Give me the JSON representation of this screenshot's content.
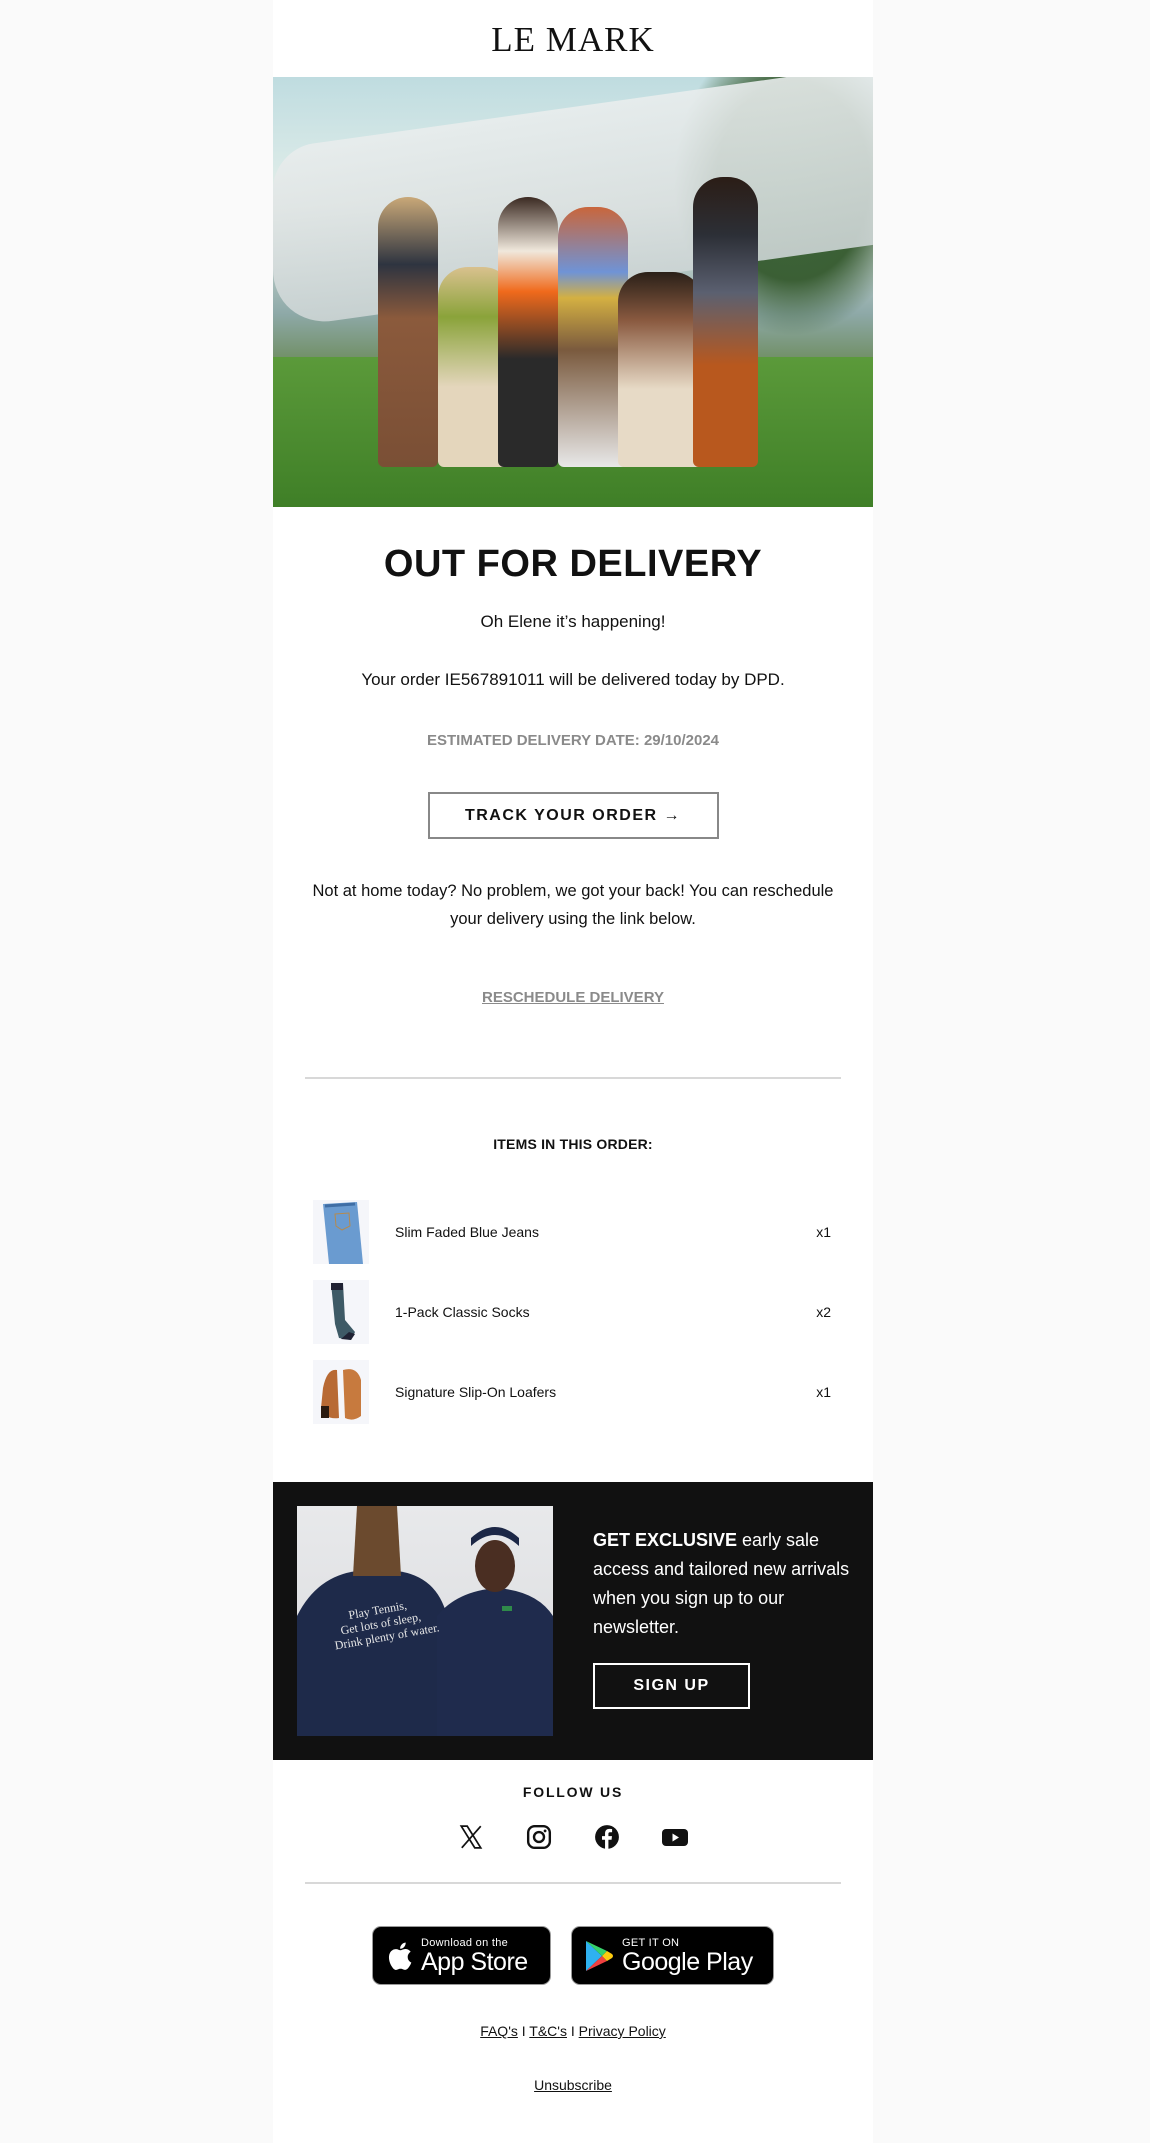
{
  "brand": {
    "logo": "LE MARK"
  },
  "hero": {
    "alt": "Group of six models in streetwear posing in front of an airplane on grass"
  },
  "status": {
    "title": "OUT FOR DELIVERY",
    "greeting": "Oh Elene it’s happening!",
    "order_message": "Your order IE567891011 will be delivered today by DPD.",
    "eta": "ESTIMATED DELIVERY DATE: 29/10/2024",
    "track_button": "TRACK YOUR ORDER →",
    "notice": "Not at home today? No problem, we got your back! You can reschedule your delivery using the link below.",
    "reschedule_link": "RESCHEDULE DELIVERY"
  },
  "items": {
    "title": "ITEMS IN THIS ORDER:",
    "list": [
      {
        "name": "Slim Faded Blue Jeans",
        "qty": "x1",
        "image": "jeans"
      },
      {
        "name": "1-Pack Classic Socks",
        "qty": "x2",
        "image": "socks"
      },
      {
        "name": "Signature Slip-On Loafers",
        "qty": "x1",
        "image": "loafers"
      }
    ]
  },
  "promo": {
    "bold": "GET EXCLUSIVE",
    "text": " early sale access and tailored new arrivals when you sign up to our newsletter.",
    "button": "SIGN UP",
    "image_caption": "Play Tennis, Get lots of sleep, Drink plenty of water."
  },
  "footer": {
    "follow_label": "FOLLOW US",
    "socials": [
      "x-icon",
      "instagram-icon",
      "facebook-icon",
      "youtube-icon"
    ],
    "app_store": {
      "small": "Download on the",
      "big": "App Store"
    },
    "google_play": {
      "small": "GET IT ON",
      "big": "Google Play"
    },
    "links": [
      "FAQ's",
      "T&C's",
      "Privacy Policy"
    ],
    "separator": "I",
    "unsubscribe": "Unsubscribe"
  }
}
